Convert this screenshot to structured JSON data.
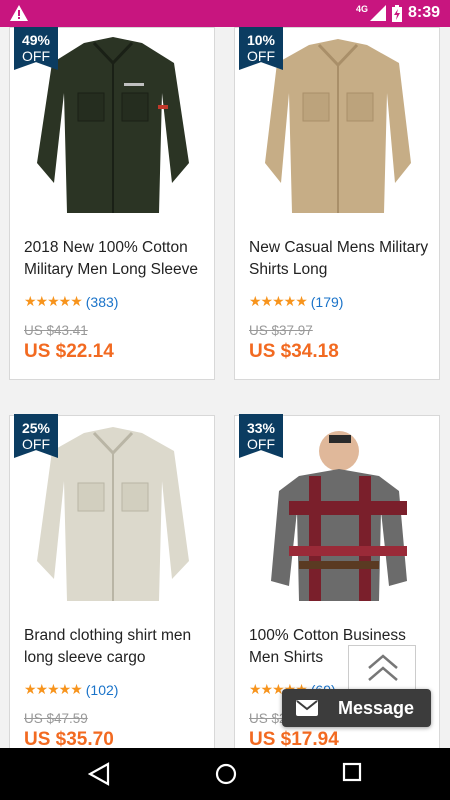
{
  "status_bar": {
    "time": "8:39",
    "network": "4G"
  },
  "products": [
    {
      "discount": "49%",
      "off": "OFF",
      "title": "2018 New 100% Cotton Military Men Long Sleeve",
      "stars": "★★★★★",
      "reviews": "(383)",
      "original_price": "US $43.41",
      "price": "US $22.14",
      "rating": 4.5
    },
    {
      "discount": "10%",
      "off": "OFF",
      "title": "New Casual Mens Military Shirts Long",
      "stars": "★★★★★",
      "reviews": "(179)",
      "original_price": "US $37.97",
      "price": "US $34.18",
      "rating": 4.5
    },
    {
      "discount": "25%",
      "off": "OFF",
      "title": "Brand clothing shirt men long sleeve cargo",
      "stars": "★★★★★",
      "reviews": "(102)",
      "original_price": "US $47.59",
      "price": "US $35.70",
      "rating": 5
    },
    {
      "discount": "33%",
      "off": "OFF",
      "title": "100% Cotton Business Men Shirts",
      "stars": "★★★★★",
      "reviews": "(69)",
      "original_price": "US $26.77",
      "price": "US $17.94",
      "rating": 4.5
    }
  ],
  "message_button": {
    "label": "Message"
  },
  "colors": {
    "status_bar": "#c8157f",
    "badge": "#0b3c61",
    "price": "#f26a21",
    "link": "#1a73c9",
    "stars": "#f7941d"
  }
}
